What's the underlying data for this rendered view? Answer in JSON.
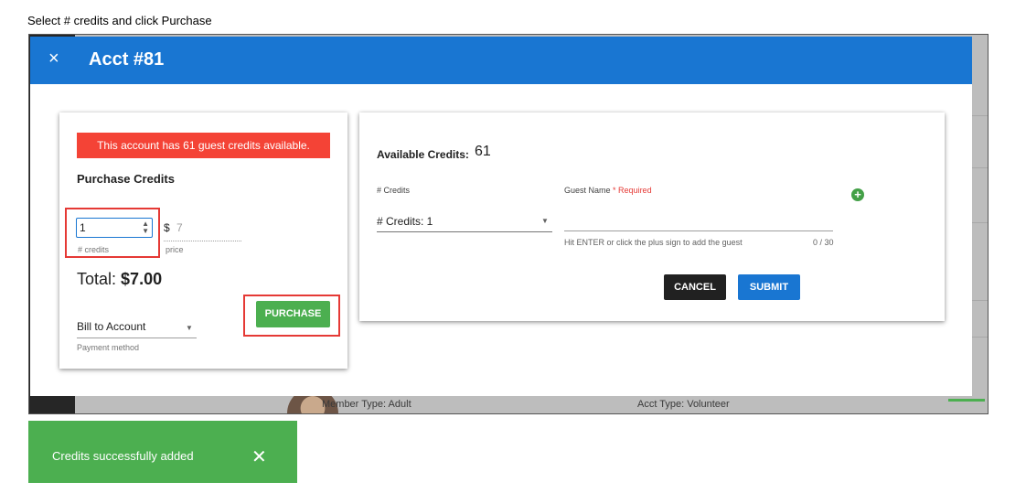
{
  "instruction": "Select # credits and click Purchase",
  "background": {
    "member_type": "Member Type: Adult",
    "acct_type": "Acct Type: Volunteer"
  },
  "dialog": {
    "close_icon": "×",
    "title": "Acct #81"
  },
  "purchase_panel": {
    "alert": "This account has 61 guest credits available.",
    "title": "Purchase Credits",
    "credits_value": "1",
    "credits_hint": "# credits",
    "currency": "$",
    "price_value": "7",
    "price_hint": "price",
    "total_label": "Total:",
    "total_value": "$7.00",
    "purchase_label": "PURCHASE",
    "billing_value": "Bill to Account",
    "billing_hint": "Payment method"
  },
  "guest_panel": {
    "available_label": "Available Credits:",
    "available_value": "61",
    "credits_label": "# Credits",
    "credits_select": "# Credits: 1",
    "guest_label": "Guest Name",
    "required_label": "* Required",
    "guest_hint": "Hit ENTER or click the plus sign to add the guest",
    "char_count": "0 / 30",
    "add_icon": "+",
    "cancel_label": "CANCEL",
    "submit_label": "SUBMIT"
  },
  "toast": {
    "message": "Credits successfully added",
    "close_icon": "✕"
  },
  "colors": {
    "header": "#1976d2",
    "alert": "#f44336",
    "success": "#4caf50",
    "highlight": "#e53935"
  }
}
